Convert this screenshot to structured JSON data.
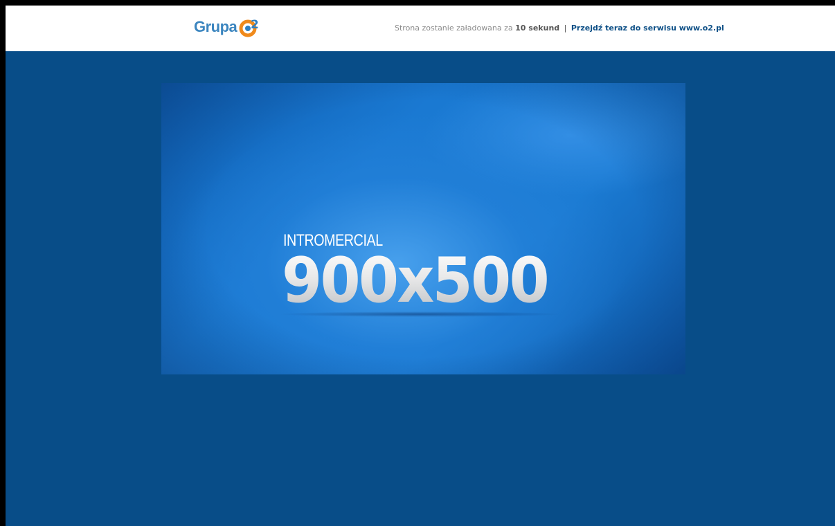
{
  "header": {
    "logo": {
      "text": "Grupa",
      "mark": "o2",
      "colors": {
        "text": "#3b85bf",
        "ring_orange": "#f08a1c",
        "ring_blue": "#2e7fc2"
      }
    },
    "notice": {
      "prefix": "Strona zostanie załadowana za",
      "countdown": "10 sekund",
      "separator": "|",
      "link_text": "Przejdź teraz do serwisu www.o2.pl"
    }
  },
  "ad": {
    "subtitle": "INTROMERCIAL",
    "title": "900x500"
  },
  "colors": {
    "page_background": "#084d88",
    "header_background": "#ffffff",
    "link": "#0d4f86"
  }
}
